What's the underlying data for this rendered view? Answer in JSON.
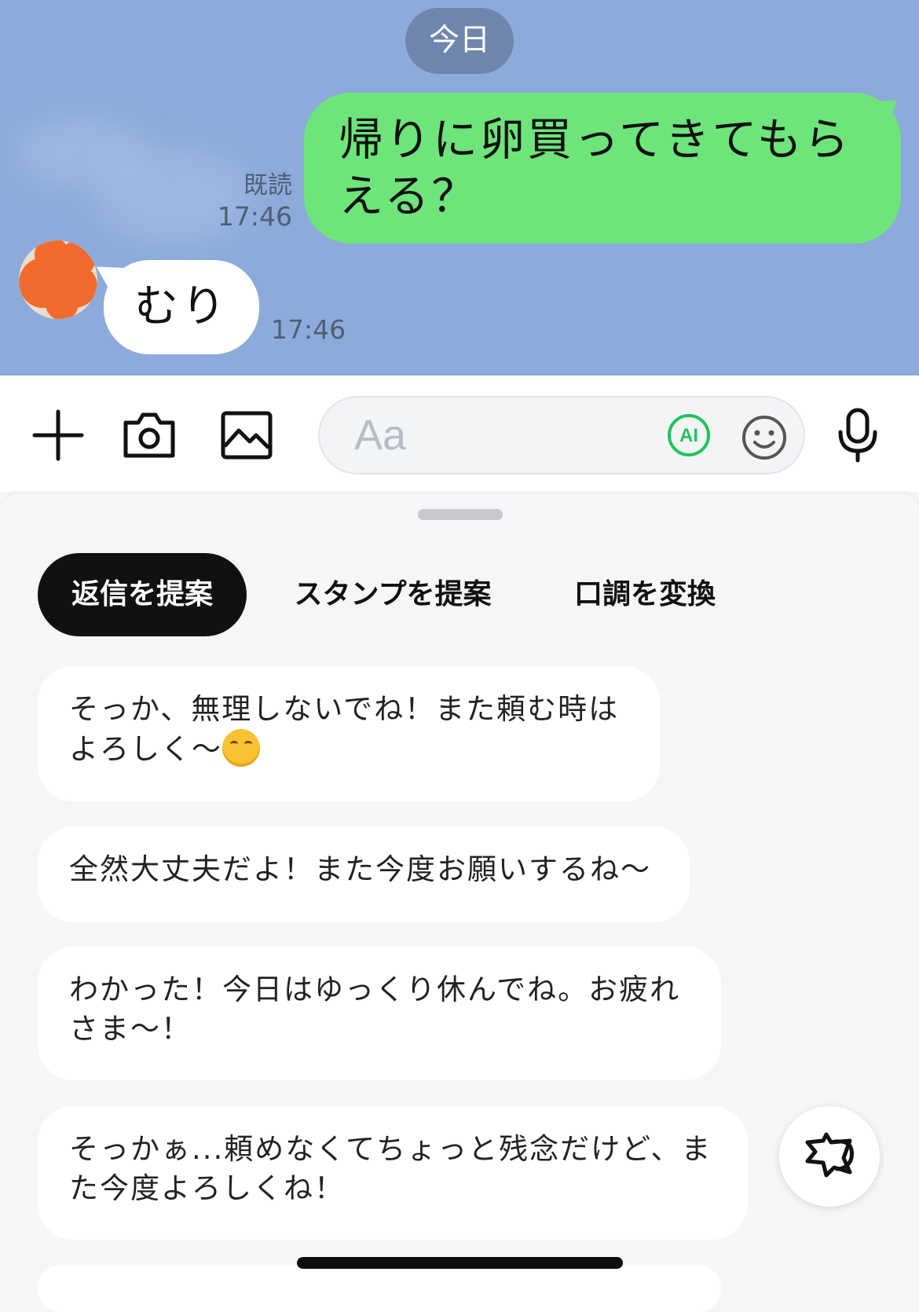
{
  "chat": {
    "date_chip": "今日",
    "outgoing": {
      "text": "帰りに卵買ってきてもらえる？",
      "read": "既読",
      "time": "17:46"
    },
    "incoming": {
      "text": "むり",
      "time": "17:46"
    }
  },
  "input": {
    "placeholder": "Aa",
    "ai_label": "AI"
  },
  "icons": [
    "plus-icon",
    "camera-icon",
    "image-icon",
    "ai-icon",
    "emoji-icon",
    "microphone-icon",
    "sticker-icon"
  ],
  "ai_panel": {
    "tabs": [
      {
        "label": "返信を提案",
        "active": true
      },
      {
        "label": "スタンプを提案",
        "active": false
      },
      {
        "label": "口調を変換",
        "active": false
      }
    ],
    "suggestions": [
      {
        "text": "そっか、無理しないでね！また頼む時はよろしく〜"
      },
      {
        "text": "全然大丈夫だよ！また今度お願いするね〜"
      },
      {
        "text": "わかった！今日はゆっくり休んでね。お疲れさま〜！"
      },
      {
        "text": "そっかぁ...頼めなくてちょっと残念だけど、また今度よろしくね！"
      }
    ]
  },
  "colors": {
    "chat_bg": "#8dabda",
    "outgoing_bubble": "#6ee57a",
    "ai_accent": "#22c35a",
    "active_tab": "#111111"
  }
}
